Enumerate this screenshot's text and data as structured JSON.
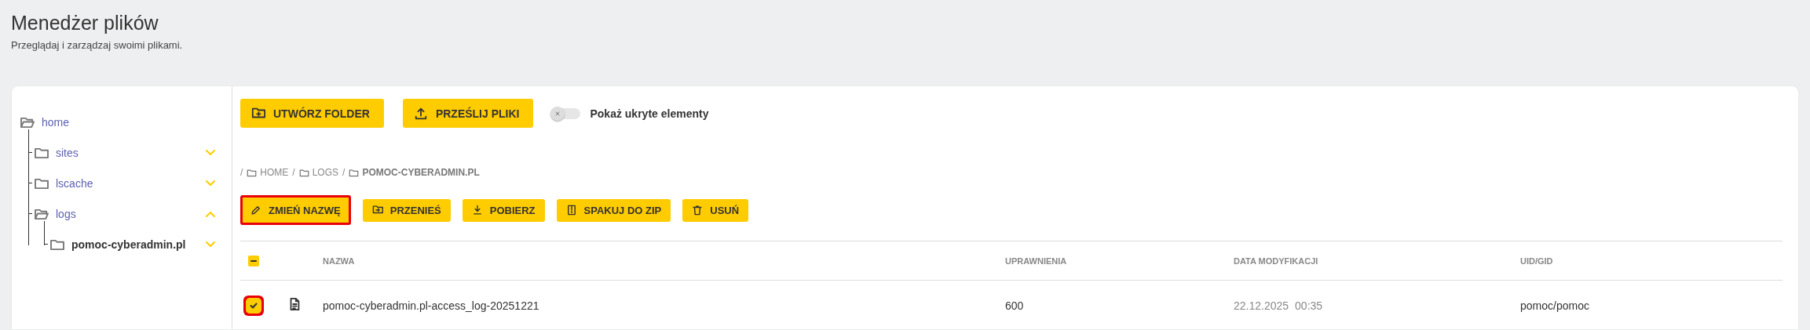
{
  "header": {
    "title": "Menedżer plików",
    "subtitle": "Przeglądaj i zarządzaj swoimi plikami."
  },
  "tree": [
    {
      "name": "home",
      "kind": "root",
      "expanded": true,
      "selected": false,
      "children": [
        {
          "name": "sites",
          "kind": "folder",
          "expanded": false,
          "selected": false
        },
        {
          "name": "lscache",
          "kind": "folder",
          "expanded": false,
          "selected": false
        },
        {
          "name": "logs",
          "kind": "folder",
          "expanded": true,
          "selected": false,
          "children": [
            {
              "name": "pomoc-cyberadmin.pl",
              "kind": "folder",
              "expanded": false,
              "selected": true
            }
          ]
        }
      ]
    }
  ],
  "toolbar": {
    "buttons": [
      {
        "kind": "new-folder",
        "label": "UTWÓRZ FOLDER"
      },
      {
        "kind": "upload",
        "label": "PRZEŚLIJ PLIKI"
      }
    ],
    "toggle": {
      "label": "Pokaż ukryte elementy",
      "on": false
    }
  },
  "breadcrumb": [
    {
      "separator": "/",
      "label": "HOME",
      "current": false
    },
    {
      "separator": "/",
      "label": "LOGS",
      "current": false
    },
    {
      "separator": "/",
      "label": "POMOC-CYBERADMIN.PL",
      "current": true
    }
  ],
  "actions": [
    {
      "kind": "rename",
      "label": "ZMIEŃ NAZWĘ",
      "highlighted": true
    },
    {
      "kind": "move",
      "label": "PRZENIEŚ",
      "highlighted": false
    },
    {
      "kind": "download",
      "label": "POBIERZ",
      "highlighted": false
    },
    {
      "kind": "zip",
      "label": "SPAKUJ DO ZIP",
      "highlighted": false
    },
    {
      "kind": "delete",
      "label": "USUŃ",
      "highlighted": false
    }
  ],
  "table": {
    "select_all": {
      "indeterminate": true
    },
    "columns": [
      "NAZWA",
      "UPRAWNIENIA",
      "DATA MODYFIKACJI",
      "UID/GID"
    ],
    "rows": [
      {
        "kind": "file",
        "checked": true,
        "highlighted": true,
        "name": "pomoc-cyberadmin.pl-access_log-20251221",
        "permissions": "600",
        "date": "22.12.2025",
        "time": "00:35",
        "owner": "pomoc/pomoc"
      }
    ]
  }
}
